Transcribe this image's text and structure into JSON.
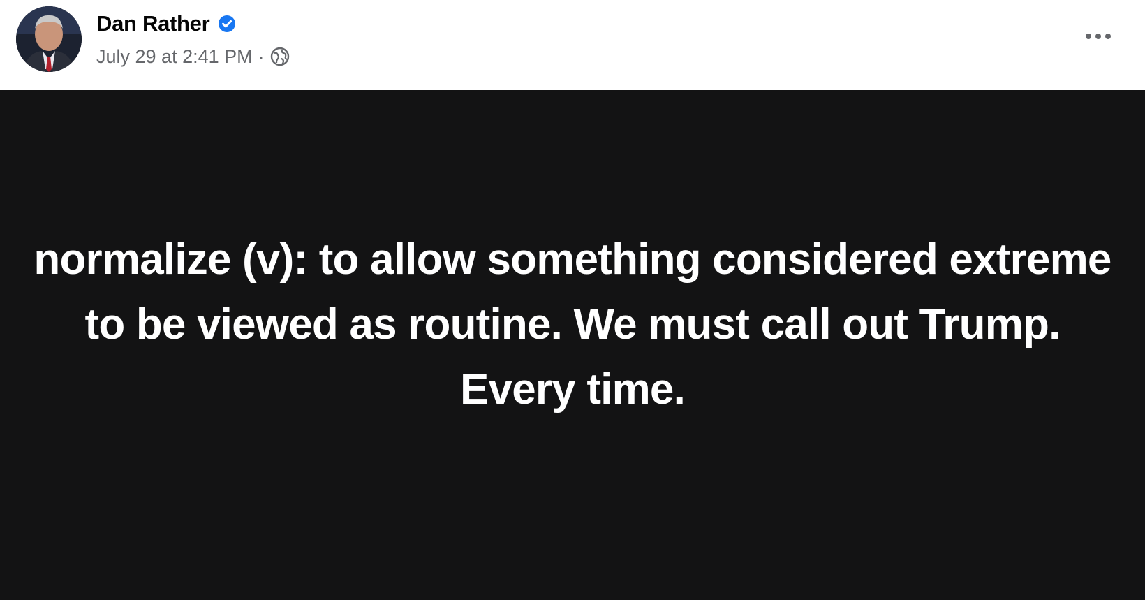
{
  "author": {
    "name": "Dan Rather",
    "verified_icon": "verified-badge-icon"
  },
  "meta": {
    "timestamp": "July 29 at 2:41 PM",
    "separator": "·",
    "audience_icon": "globe-icon"
  },
  "post": {
    "text": "normalize (v): to allow something considered extreme to be viewed as routine. We must call out Trump. Every time."
  },
  "more_icon": "more-options-icon",
  "colors": {
    "card_background": "#131314",
    "card_text": "#ffffff",
    "verified_blue": "#1877f2",
    "secondary_text": "#65676b"
  }
}
